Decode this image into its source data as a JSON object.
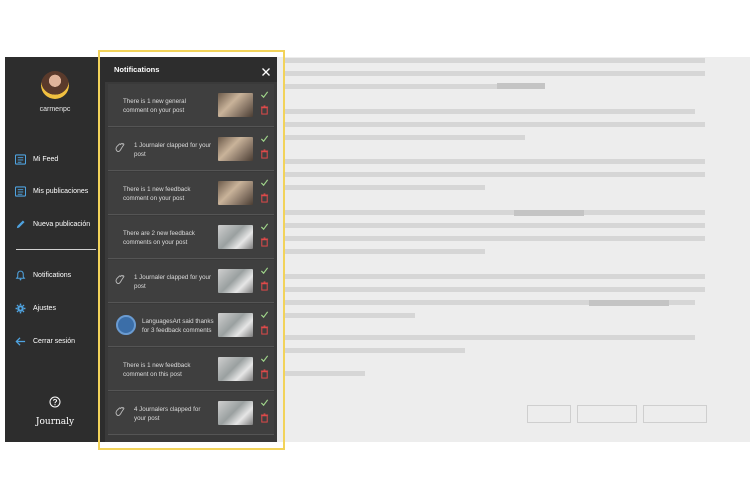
{
  "sidebar": {
    "username": "carmenpc",
    "nav_items": [
      {
        "label": "Mi Feed",
        "icon": "feed-icon"
      },
      {
        "label": "Mis publicaciones",
        "icon": "posts-icon"
      },
      {
        "label": "Nueva publicación",
        "icon": "pencil-icon"
      },
      {
        "label": "Notifications",
        "icon": "bell-icon"
      },
      {
        "label": "Ajustes",
        "icon": "gear-icon"
      },
      {
        "label": "Cerrar sesión",
        "icon": "arrow-left-icon"
      }
    ],
    "help_icon": "question-icon",
    "brand": "Journaly"
  },
  "notifications": {
    "title": "Notifications",
    "close_icon": "close-icon",
    "items": [
      {
        "text": "There is 1 new general comment on your post",
        "lead": "none",
        "thumb": "book-photo"
      },
      {
        "text": "1 Journaler clapped for your post",
        "lead": "clap-icon",
        "thumb": "book-photo"
      },
      {
        "text": "There is 1 new feedback comment on your post",
        "lead": "none",
        "thumb": "book-photo"
      },
      {
        "text": "There are 2 new feedback comments on your post",
        "lead": "none",
        "thumb": "office-photo"
      },
      {
        "text": "1 Journaler clapped for your post",
        "lead": "clap-icon",
        "thumb": "office-photo"
      },
      {
        "text": "LanguagesArt said thanks for 3 feedback comments",
        "lead": "user-avatar",
        "thumb": "office-photo"
      },
      {
        "text": "There is 1 new feedback comment on this post",
        "lead": "none",
        "thumb": "office-photo"
      },
      {
        "text": "4 Journalers clapped for your post",
        "lead": "clap-icon",
        "thumb": "office-photo"
      }
    ]
  },
  "colors": {
    "sidebar_bg": "#2d2d2d",
    "panel_bg": "#3a3a3a",
    "check": "#9fd48a",
    "trash": "#e04a4a",
    "nav_icon": "#4fa3e0"
  }
}
